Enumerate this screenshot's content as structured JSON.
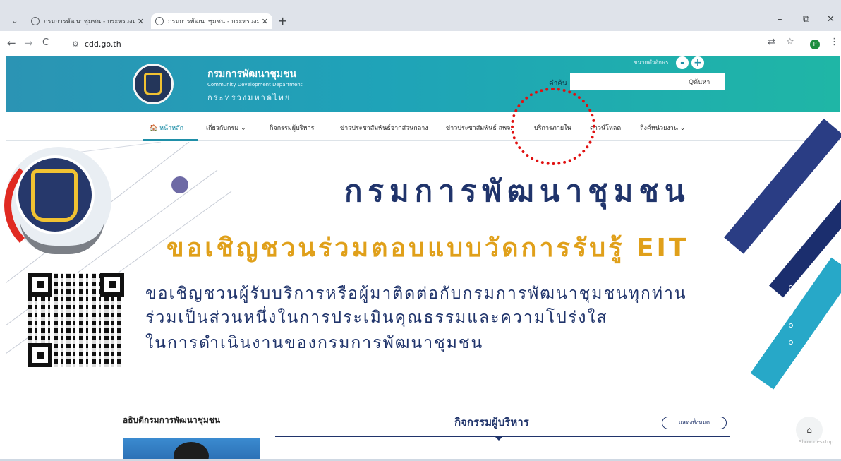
{
  "browser": {
    "tabs": [
      {
        "title": "กรมการพัฒนาชุมชน - กระทรวงมหา",
        "close": "✕"
      },
      {
        "title": "กรมการพัฒนาชุมชน - กระทรวงมหา",
        "close": "✕"
      }
    ],
    "new_tab": "+",
    "tab_menu": "⌄",
    "window_buttons": [
      "–",
      "⧉",
      "✕"
    ],
    "address": "cdd.go.th",
    "nav": {
      "back": "←",
      "forward": "→",
      "reload": "C"
    },
    "profile_initial": "P"
  },
  "site": {
    "brand_th": "กรมการพัฒนาชุมชน",
    "brand_en": "Community Development Department",
    "ministry": "กระทรวงมหาดไทย",
    "font_size_label": "ขนาดตัวอักษร",
    "font_minus": "-",
    "font_plus": "+",
    "search_label": "คำค้น",
    "search_button": "Qค้นหา"
  },
  "mainnav": {
    "items": [
      {
        "label": "🏠 หน้าหลัก"
      },
      {
        "label": "เกี่ยวกับกรม ⌄"
      },
      {
        "label": "กิจกรรมผู้บริหาร"
      },
      {
        "label": "ข่าวประชาสัมพันธ์จากส่วนกลาง"
      },
      {
        "label": "ข่าวประชาสัมพันธ์ สพจ."
      },
      {
        "label": "บริการภายใน"
      },
      {
        "label": "ดาวน์โหลด"
      },
      {
        "label": "ลิงค์หน่วยงาน ⌄"
      }
    ]
  },
  "banner": {
    "title": "กรมการพัฒนาชุมชน",
    "subtitle": "ขอเชิญชวนร่วมตอบแบบวัดการรับรู้ EIT",
    "lines": [
      "ขอเชิญชวนผู้รับบริการหรือผู้มาติดต่อกับกรมการพัฒนาชุมชนทุกท่าน",
      "ร่วมเป็นส่วนหนึ่งในการประเมินคุณธรรมและความโปร่งใส",
      "ในการดำเนินงานของกรมการพัฒนาชุมชน"
    ]
  },
  "sections": {
    "director": "อธิบดีกรมการพัฒนาชุมชน",
    "activities": "กิจกรรมผู้บริหาร",
    "show_all": "แสดงทั้งหมด",
    "show_desktop": "Show desktop"
  },
  "colors": {
    "header_start": "#2b94b4",
    "header_end": "#1fb6a6",
    "navy": "#20346b",
    "gold": "#e0a01a",
    "annotation": "#e01010"
  }
}
